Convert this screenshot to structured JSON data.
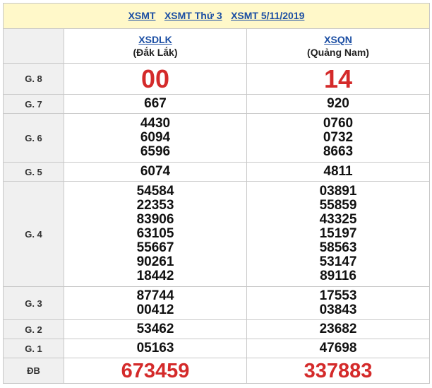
{
  "header": {
    "links": [
      "XSMT",
      "XSMT Thứ 3",
      "XSMT 5/11/2019"
    ]
  },
  "provinces": [
    {
      "code": "XSDLK",
      "name": "(Đắk Lắk)"
    },
    {
      "code": "XSQN",
      "name": "(Quảng Nam)"
    }
  ],
  "prizes": [
    {
      "label": "G. 8",
      "values": [
        [
          "00"
        ],
        [
          "14"
        ]
      ]
    },
    {
      "label": "G. 7",
      "values": [
        [
          "667"
        ],
        [
          "920"
        ]
      ]
    },
    {
      "label": "G. 6",
      "values": [
        [
          "4430",
          "6094",
          "6596"
        ],
        [
          "0760",
          "0732",
          "8663"
        ]
      ]
    },
    {
      "label": "G. 5",
      "values": [
        [
          "6074"
        ],
        [
          "4811"
        ]
      ]
    },
    {
      "label": "G. 4",
      "values": [
        [
          "54584",
          "22353",
          "83906",
          "63105",
          "55667",
          "90261",
          "18442"
        ],
        [
          "03891",
          "55859",
          "43325",
          "15197",
          "58563",
          "53147",
          "89116"
        ]
      ]
    },
    {
      "label": "G. 3",
      "values": [
        [
          "87744",
          "00412"
        ],
        [
          "17553",
          "03843"
        ]
      ]
    },
    {
      "label": "G. 2",
      "values": [
        [
          "53462"
        ],
        [
          "23682"
        ]
      ]
    },
    {
      "label": "G. 1",
      "values": [
        [
          "05163"
        ],
        [
          "47698"
        ]
      ]
    },
    {
      "label": "ĐB",
      "values": [
        [
          "673459"
        ],
        [
          "337883"
        ]
      ]
    }
  ],
  "colors": {
    "link": "#1b4ea3",
    "highlight": "#d42a2a",
    "header_bg": "#fff8c9",
    "label_bg": "#f0f0f0"
  }
}
